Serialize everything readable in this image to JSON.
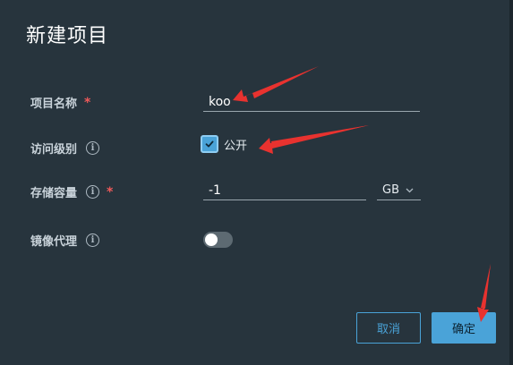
{
  "dialog": {
    "title": "新建项目"
  },
  "form": {
    "project_name": {
      "label": "项目名称",
      "required_mark": "*",
      "value": "koo"
    },
    "access_level": {
      "label": "访问级别",
      "info_icon": "info-icon",
      "checkbox_checked": true,
      "checkbox_label": "公开"
    },
    "storage_capacity": {
      "label": "存储容量",
      "info_icon": "info-icon",
      "required_mark": "*",
      "value": "-1",
      "unit": "GB",
      "unit_icon": "chevron-down-icon"
    },
    "mirror_proxy": {
      "label": "镜像代理",
      "info_icon": "info-icon",
      "enabled": false
    }
  },
  "actions": {
    "cancel_label": "取消",
    "confirm_label": "确定"
  },
  "colors": {
    "background": "#27343d",
    "accent": "#4aa3d8",
    "required": "#f05a5a",
    "annotation_arrow": "#e8322f"
  }
}
